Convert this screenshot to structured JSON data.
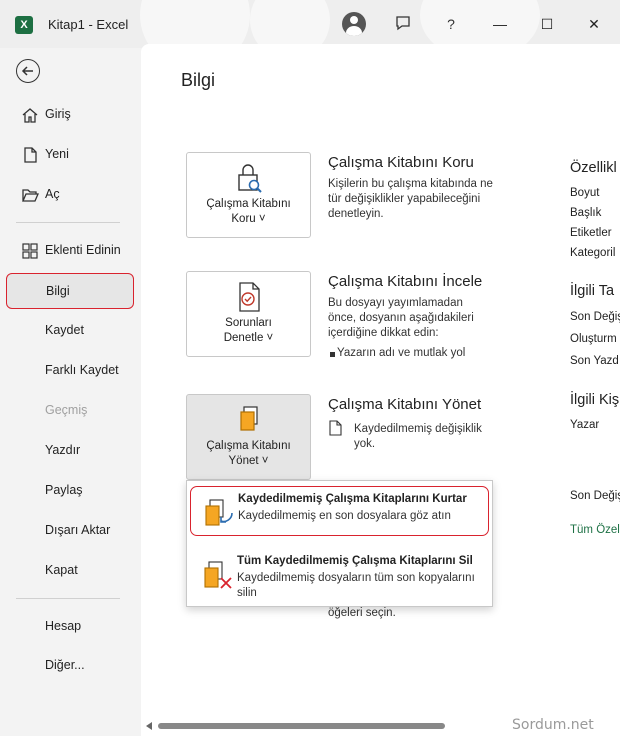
{
  "app": {
    "title": "Kitap1  -  Excel",
    "logo_letter": "X",
    "help_symbol": "?",
    "minimize_symbol": "—",
    "maximize_symbol": "☐",
    "close_symbol": "✕"
  },
  "sidebar": {
    "items": [
      {
        "label": "Giriş",
        "icon": "home-icon"
      },
      {
        "label": "Yeni",
        "icon": "new-document-icon"
      },
      {
        "label": "Aç",
        "icon": "folder-open-icon"
      },
      {
        "label": "Eklenti Edinin",
        "icon": "add-ins-icon"
      },
      {
        "label": "Bilgi",
        "active": true
      },
      {
        "label": "Kaydet"
      },
      {
        "label": "Farklı Kaydet"
      },
      {
        "label": "Geçmiş",
        "disabled": true
      },
      {
        "label": "Yazdır"
      },
      {
        "label": "Paylaş"
      },
      {
        "label": "Dışarı Aktar"
      },
      {
        "label": "Kapat"
      },
      {
        "label": "Hesap"
      },
      {
        "label": "Diğer..."
      }
    ]
  },
  "main": {
    "title": "Bilgi",
    "sections": [
      {
        "button_line1": "Çalışma Kitabını",
        "button_line2": "Koru ˅",
        "title": "Çalışma Kitabını Koru",
        "description": "Kişilerin bu çalışma kitabında ne tür değişiklikler yapabileceğini denetleyin."
      },
      {
        "button_line1": "Sorunları",
        "button_line2": "Denetle ˅",
        "title": "Çalışma Kitabını İncele",
        "description": "Bu dosyayı yayımlamadan önce, dosyanın aşağıdakileri içerdiğine dikkat edin:",
        "bullet": "Yazarın adı ve mutlak yol"
      },
      {
        "button_line1": "Çalışma Kitabını",
        "button_line2": "Yönet ˅",
        "title": "Çalışma Kitabını Yönet",
        "description": "Kaydedilmemiş değişiklik yok."
      }
    ],
    "hidden_text": "öğeleri seçin.",
    "dropdown": [
      {
        "title": "Kaydedilmemiş Çalışma Kitaplarını Kurtar",
        "description": "Kaydedilmemiş en son dosyalara göz atın",
        "highlighted": true
      },
      {
        "title": "Tüm Kaydedilmemiş Çalışma Kitaplarını Sil",
        "description": "Kaydedilmemiş dosyaların tüm son kopyalarını silin"
      }
    ]
  },
  "properties": {
    "heading": "Özellikl",
    "rows": [
      "Boyut",
      "Başlık",
      "Etiketler",
      "Kategoril"
    ],
    "related_dates_heading": "İlgili Ta",
    "date_rows": [
      "Son Değiş",
      "Oluşturm",
      "Son Yazd"
    ],
    "related_people_heading": "İlgili Kiş",
    "people_rows": [
      "Yazar"
    ],
    "last_modified_by": "Son Değiş",
    "show_all_link": "Tüm Özel"
  },
  "watermark": "Sordum.net",
  "colors": {
    "excel_green": "#1d6f42",
    "highlight_red": "#d9232e",
    "link_green": "#1e7145"
  }
}
